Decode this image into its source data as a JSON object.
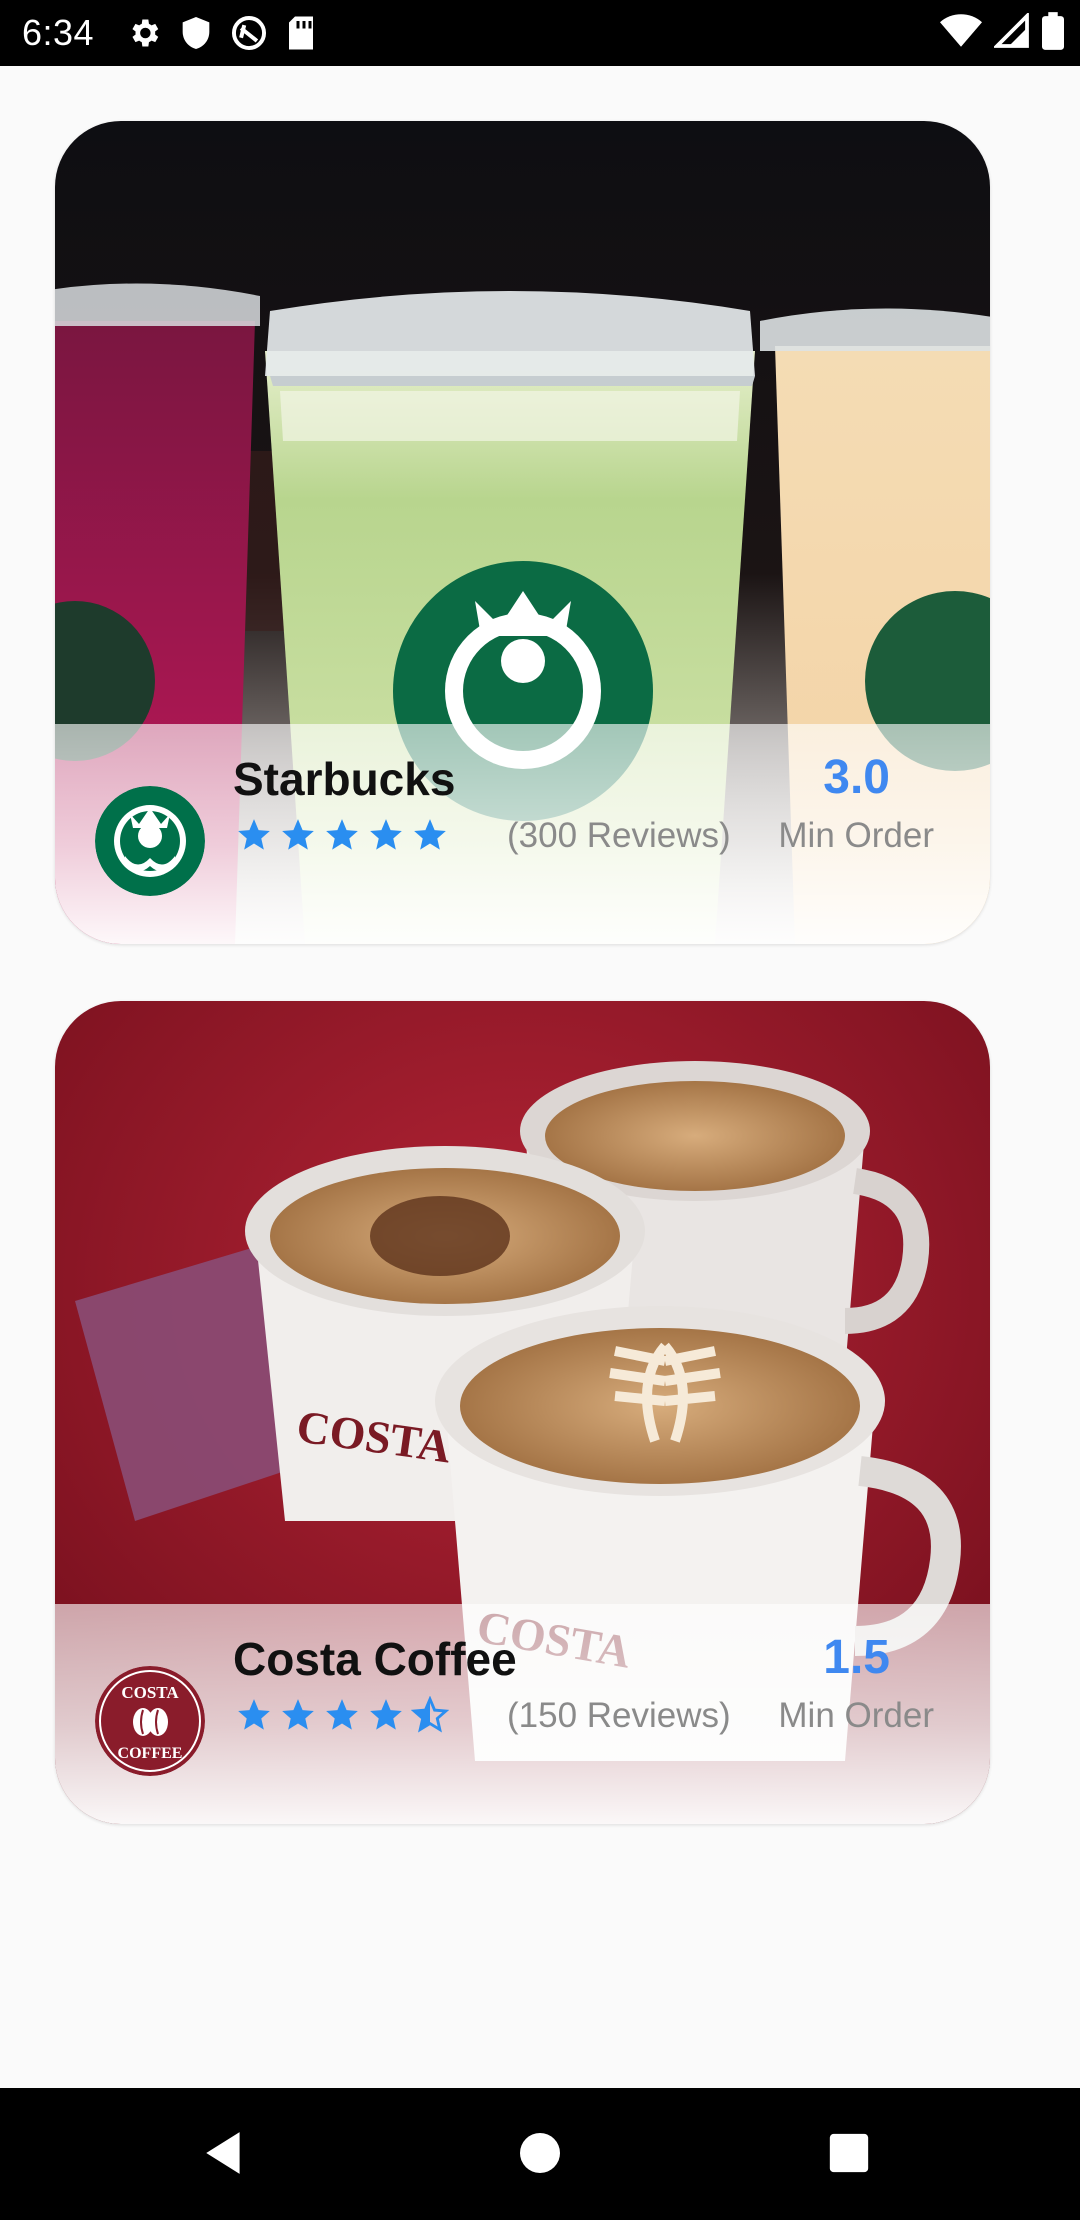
{
  "status_bar": {
    "time": "6:34",
    "icons": [
      "gear-icon",
      "shield-icon",
      "vpn-icon",
      "sd-card-icon",
      "wifi-icon",
      "signal-icon",
      "battery-icon"
    ]
  },
  "shops": [
    {
      "name": "Starbucks",
      "rating": 5,
      "reviews_text": "(300 Reviews)",
      "min_order_value": "3.0",
      "min_order_label": "Min Order",
      "logo": "starbucks-logo",
      "image": "iced-drinks-photo"
    },
    {
      "name": "Costa Coffee",
      "rating": 4.5,
      "reviews_text": "(150 Reviews)",
      "min_order_value": "1.5",
      "min_order_label": "Min Order",
      "logo": "costa-logo",
      "image": "coffee-cups-photo"
    }
  ],
  "colors": {
    "star": "#2a8ef0",
    "min_order_value": "#3f88f0",
    "muted_text": "#8a8a8a",
    "starbucks_green": "#00704a",
    "costa_red": "#8a1c2b"
  },
  "nav_bar": {
    "buttons": [
      "back-icon",
      "home-icon",
      "recents-icon"
    ]
  }
}
